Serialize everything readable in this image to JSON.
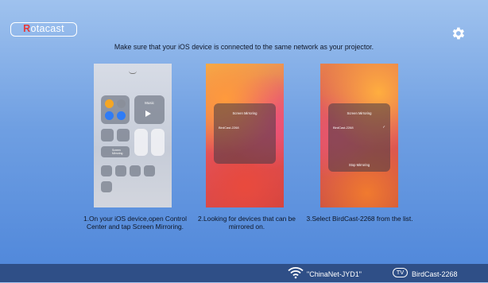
{
  "app": {
    "logo_first": "R",
    "logo_rest": "otacast"
  },
  "header": {
    "instruction": "Make sure that your iOS device is connected to the same network as your projector."
  },
  "steps": [
    {
      "caption": "1.On your iOS device,open Control Center and tap Screen Mirroring."
    },
    {
      "caption": "2.Looking for devices that can be mirrored on."
    },
    {
      "caption": "3.Select BirdCast-2268 from the list."
    }
  ],
  "screens": {
    "cc": {
      "music": "Music",
      "screen_mirroring": "Screen Mirroring"
    },
    "list1": {
      "title": "Screen Mirroring",
      "device": "BirdCast-2268"
    },
    "list2": {
      "title": "Screen Mirroring",
      "device": "BirdCast-2268",
      "stop": "Stop Mirroring"
    }
  },
  "footer": {
    "ssid": "\"ChinaNet-JYD1\"",
    "tv_badge": "TV",
    "device_name": "BirdCast-2268"
  },
  "colors": {
    "accent": "#e53a3a",
    "footer_bg": "#2f4f87"
  },
  "icons": [
    "settings-gear-icon",
    "wifi-icon",
    "tv-icon"
  ]
}
